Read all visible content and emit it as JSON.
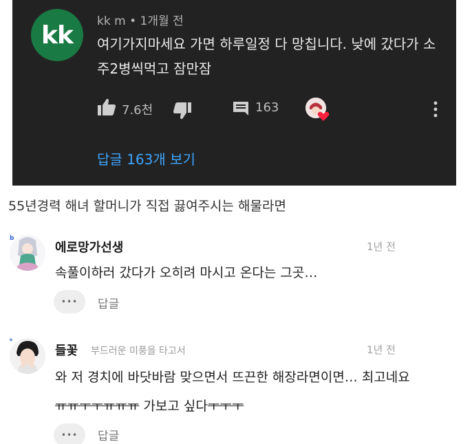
{
  "youtube_comment": {
    "avatar_text": "kk",
    "author": "kk m",
    "separator": "•",
    "time": "1개월 전",
    "text": "여기가지마세요 가면 하루일정 다 망칩니다. 낮에 갔다가 소주2병씩먹고 잠만잠",
    "like_count": "7.6천",
    "reply_count": "163",
    "view_replies_label": "답글 163개 보기",
    "colors": {
      "background": "#222222",
      "link": "#3ea6ff",
      "avatar": "#1a7a43"
    }
  },
  "caption": "55년경력 해녀 할머니가 직접 끓여주시는 해물라면",
  "comments": [
    {
      "author": "에로망가선생",
      "time": "1년 전",
      "text": "속풀이하러 갔다가 오히려 마시고 온다는 그곳…",
      "more_label": "•••",
      "reply_label": "답글"
    },
    {
      "author": "들꽃",
      "subtitle": "부드러운 미풍을 타고서",
      "time": "1년 전",
      "text_main": "와 저 경치에 바닷바람 맞으면서 뜨끈한 해장라면이면… 최고네요",
      "text_strike_1": "ㅠㅠㅜㅜㅠㅠㅠ",
      "text_middle": " 가보고 싶다",
      "text_strike_2": "ㅜㅜㅜ",
      "more_label": "•••",
      "reply_label": "답글"
    }
  ]
}
